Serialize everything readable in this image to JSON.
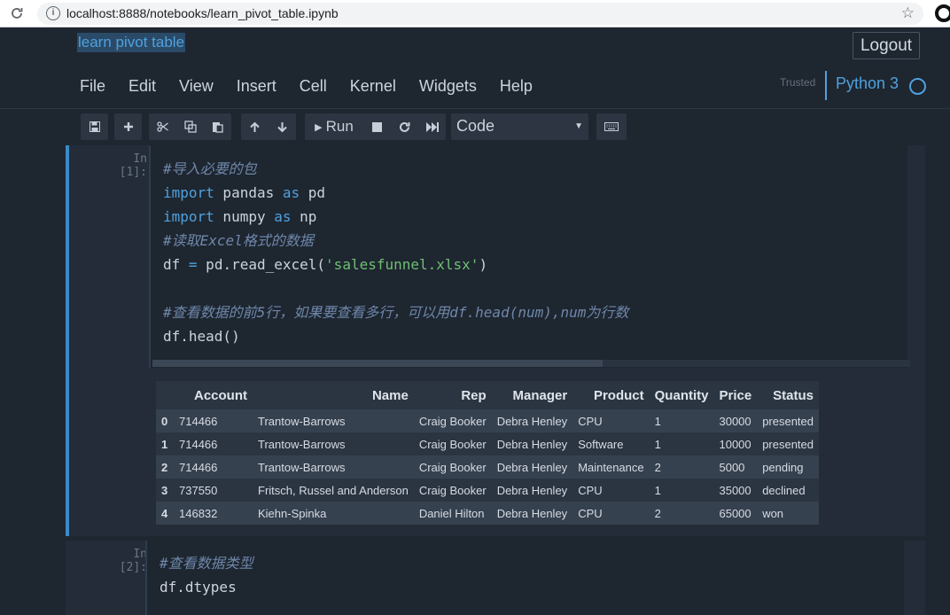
{
  "browser": {
    "url": "localhost:8888/notebooks/learn_pivot_table.ipynb"
  },
  "header": {
    "notebook_title": "learn pivot table",
    "logout_label": "Logout",
    "trusted_label": "Trusted",
    "kernel_name": "Python 3"
  },
  "menu": [
    "File",
    "Edit",
    "View",
    "Insert",
    "Cell",
    "Kernel",
    "Widgets",
    "Help"
  ],
  "toolbar": {
    "run_label": "Run",
    "cell_type": "Code"
  },
  "cells": [
    {
      "prompt": "In [1]:",
      "lines": {
        "l1": "#导入必要的包",
        "l2_kw1": "import",
        "l2_mod": " pandas ",
        "l2_kw2": "as",
        "l2_alias": " pd",
        "l3_kw1": "import",
        "l3_mod": " numpy ",
        "l3_kw2": "as",
        "l3_alias": " np",
        "l4": "#读取Excel格式的数据",
        "l5_a": "df ",
        "l5_op": "=",
        "l5_b": " pd.read_excel(",
        "l5_str": "'salesfunnel.xlsx'",
        "l5_c": ")",
        "l7": "#查看数据的前5行，如果要查看多行，可以用df.head(num),num为行数",
        "l8": "df.head()"
      }
    },
    {
      "prompt": "In [2]:",
      "lines": {
        "l1": "#查看数据类型",
        "l2": "df.dtypes"
      }
    }
  ],
  "table": {
    "columns": [
      "",
      "Account",
      "Name",
      "Rep",
      "Manager",
      "Product",
      "Quantity",
      "Price",
      "Status"
    ],
    "rows": [
      [
        "0",
        "714466",
        "Trantow-Barrows",
        "Craig Booker",
        "Debra Henley",
        "CPU",
        "1",
        "30000",
        "presented"
      ],
      [
        "1",
        "714466",
        "Trantow-Barrows",
        "Craig Booker",
        "Debra Henley",
        "Software",
        "1",
        "10000",
        "presented"
      ],
      [
        "2",
        "714466",
        "Trantow-Barrows",
        "Craig Booker",
        "Debra Henley",
        "Maintenance",
        "2",
        "5000",
        "pending"
      ],
      [
        "3",
        "737550",
        "Fritsch, Russel and Anderson",
        "Craig Booker",
        "Debra Henley",
        "CPU",
        "1",
        "35000",
        "declined"
      ],
      [
        "4",
        "146832",
        "Kiehn-Spinka",
        "Daniel Hilton",
        "Debra Henley",
        "CPU",
        "2",
        "65000",
        "won"
      ]
    ]
  },
  "colors": {
    "background": "#1e2630",
    "accent": "#4fa1dd",
    "cell_bg": "#232c38"
  }
}
